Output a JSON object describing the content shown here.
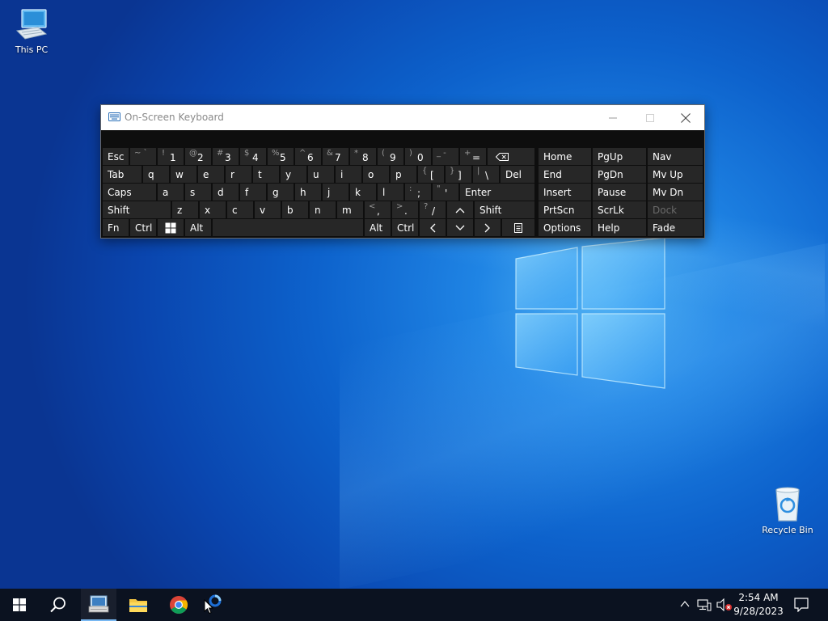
{
  "desktop": {
    "icons": [
      {
        "label": "This PC"
      },
      {
        "label": "Recycle Bin"
      }
    ]
  },
  "osk": {
    "title": "On-Screen Keyboard",
    "keys": {
      "esc": "Esc",
      "tilde": {
        "top": "~ `",
        "main": ""
      },
      "n1": {
        "top": "!",
        "main": "1"
      },
      "n2": {
        "top": "@",
        "main": "2"
      },
      "n3": {
        "top": "#",
        "main": "3"
      },
      "n4": {
        "top": "$",
        "main": "4"
      },
      "n5": {
        "top": "%",
        "main": "5"
      },
      "n6": {
        "top": "^",
        "main": "6"
      },
      "n7": {
        "top": "&",
        "main": "7"
      },
      "n8": {
        "top": "*",
        "main": "8"
      },
      "n9": {
        "top": "(",
        "main": "9"
      },
      "n0": {
        "top": ")",
        "main": "0"
      },
      "minus": {
        "top": "_ -",
        "main": ""
      },
      "equals": {
        "top": "+",
        "main": "="
      },
      "tab": "Tab",
      "q": "q",
      "w": "w",
      "e": "e",
      "r": "r",
      "t": "t",
      "y": "y",
      "u": "u",
      "i": "i",
      "o": "o",
      "p": "p",
      "lbracket": {
        "top": "{",
        "main": "["
      },
      "rbracket": {
        "top": "}",
        "main": "]"
      },
      "backslash": {
        "top": "|",
        "main": "\\"
      },
      "del": "Del",
      "caps": "Caps",
      "a": "a",
      "s": "s",
      "d": "d",
      "f": "f",
      "g": "g",
      "h": "h",
      "j": "j",
      "k": "k",
      "l": "l",
      "semicolon": {
        "top": ":",
        "main": ";"
      },
      "quote": {
        "top": "\"",
        "main": "'"
      },
      "enter": "Enter",
      "shift_l": "Shift",
      "z": "z",
      "x": "x",
      "c": "c",
      "v": "v",
      "b": "b",
      "n": "n",
      "m": "m",
      "comma": {
        "top": "<",
        "main": ","
      },
      "period": {
        "top": ">",
        "main": "."
      },
      "slash": {
        "top": "?",
        "main": "/"
      },
      "shift_r": "Shift",
      "fn": "Fn",
      "ctrl_l": "Ctrl",
      "alt_l": "Alt",
      "alt_r": "Alt",
      "ctrl_r": "Ctrl",
      "home": "Home",
      "pgup": "PgUp",
      "nav": "Nav",
      "end": "End",
      "pgdn": "PgDn",
      "mvup": "Mv Up",
      "insert": "Insert",
      "pause": "Pause",
      "mvdn": "Mv Dn",
      "prtscn": "PrtScn",
      "scrlk": "ScrLk",
      "dock": "Dock",
      "options": "Options",
      "help": "Help",
      "fade": "Fade"
    }
  },
  "taskbar": {
    "time": "2:54 AM",
    "date": "9/28/2023"
  },
  "colors": {
    "desktop_accent": "#0d62cc",
    "osk_key_bg": "#272727",
    "taskbar_bg": "#0b1220",
    "active_indicator": "#79b8f2"
  }
}
